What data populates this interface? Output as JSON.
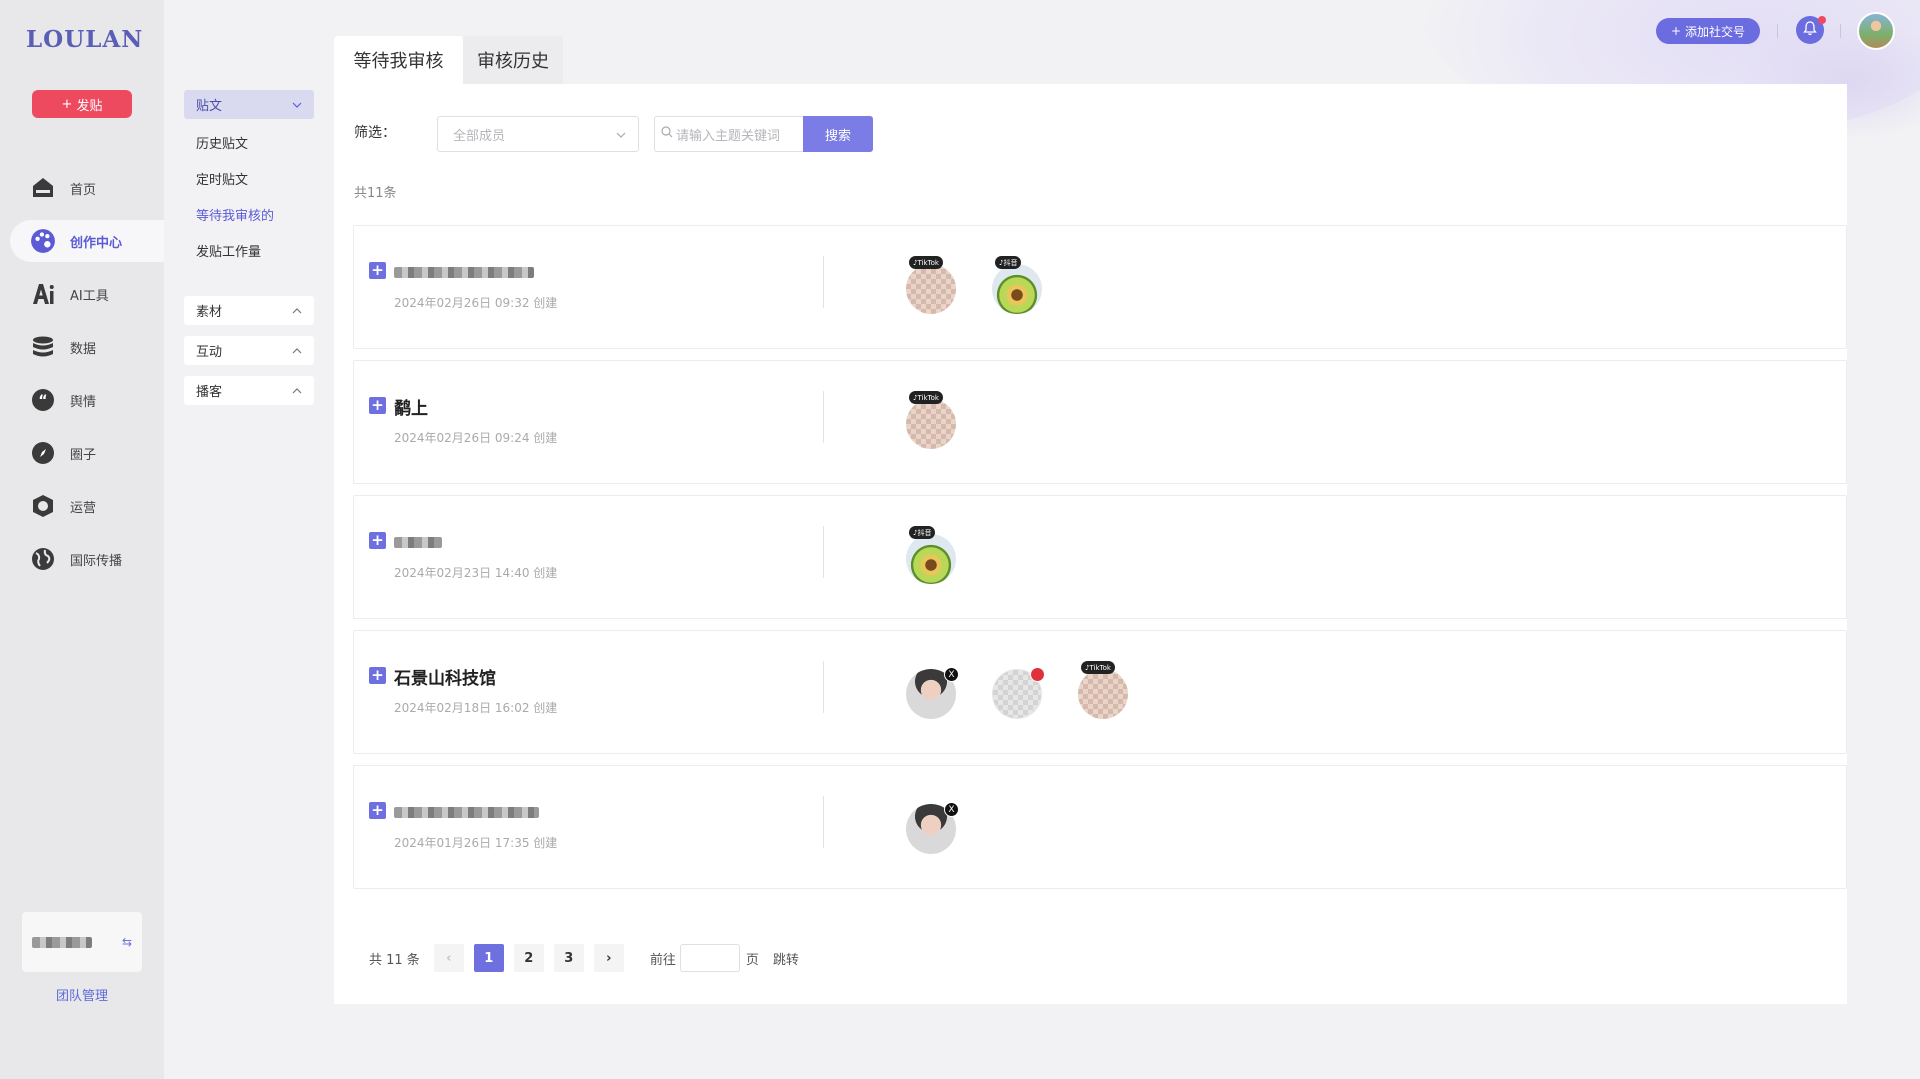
{
  "app": {
    "logo": "LOULAN"
  },
  "sidebar": {
    "post_button": "发贴",
    "items": [
      {
        "label": "首页",
        "icon": "home-icon"
      },
      {
        "label": "创作中心",
        "icon": "palette-icon",
        "active": true
      },
      {
        "label": "AI工具",
        "icon": "ai-icon"
      },
      {
        "label": "数据",
        "icon": "database-icon"
      },
      {
        "label": "舆情",
        "icon": "quote-icon"
      },
      {
        "label": "圈子",
        "icon": "compass-icon"
      },
      {
        "label": "运营",
        "icon": "operations-icon"
      },
      {
        "label": "国际传播",
        "icon": "globe-icon"
      }
    ],
    "team_management": "团队管理"
  },
  "submenu": {
    "posts_header": "贴文",
    "posts_items": [
      "历史贴文",
      "定时贴文",
      "等待我审核的",
      "发贴工作量"
    ],
    "materials": "素材",
    "interaction": "互动",
    "broadcast": "播客"
  },
  "topbar": {
    "add_social": "添加社交号"
  },
  "tabs": [
    "等待我审核",
    "审核历史"
  ],
  "filter": {
    "label": "筛选：",
    "member_select": "全部成员",
    "search_placeholder": "请输入主题关键词",
    "search_button": "搜索",
    "total": "共11条"
  },
  "posts": [
    {
      "title": "",
      "title_blurred": true,
      "date": "2024年02月26日 09:32 创建",
      "accounts": [
        {
          "type": "tiktok",
          "badge": "TikTok"
        },
        {
          "type": "douyin",
          "badge": "抖音"
        }
      ]
    },
    {
      "title": "鹬上",
      "title_blurred": false,
      "date": "2024年02月26日 09:24 创建",
      "accounts": [
        {
          "type": "tiktok",
          "badge": "TikTok"
        }
      ]
    },
    {
      "title": "",
      "title_blurred": true,
      "date": "2024年02月23日 14:40 创建",
      "accounts": [
        {
          "type": "douyin",
          "badge": "抖音"
        }
      ]
    },
    {
      "title": "石景山科技馆",
      "title_blurred": false,
      "date": "2024年02月18日 16:02 创建",
      "accounts": [
        {
          "type": "x",
          "badge": "X"
        },
        {
          "type": "xiaohongshu",
          "badge": ""
        },
        {
          "type": "tiktok",
          "badge": "TikTok"
        }
      ]
    },
    {
      "title": "",
      "title_blurred": true,
      "date": "2024年01月26日 17:35 创建",
      "accounts": [
        {
          "type": "x",
          "badge": "X"
        }
      ]
    }
  ],
  "pagination": {
    "total": "共 11 条",
    "pages": [
      "1",
      "2",
      "3"
    ],
    "current": "1",
    "goto_label": "前往",
    "page_unit": "页",
    "jump": "跳转"
  },
  "colors": {
    "accent": "#6f70e0",
    "post_button": "#ee4a5f",
    "active_nav": "#5b5bd6"
  }
}
